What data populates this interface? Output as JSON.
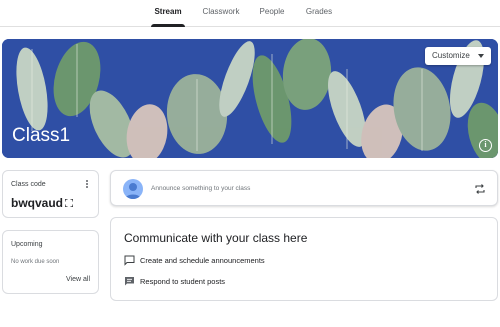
{
  "tabs": [
    {
      "label": "Stream",
      "active": true
    },
    {
      "label": "Classwork",
      "active": false
    },
    {
      "label": "People",
      "active": false
    },
    {
      "label": "Grades",
      "active": false
    }
  ],
  "banner": {
    "class_name": "Class1",
    "customize_label": "Customize",
    "info_glyph": "i",
    "background_color": "#2f4fa5"
  },
  "class_code": {
    "label": "Class code",
    "value": "bwqvaud"
  },
  "upcoming": {
    "title": "Upcoming",
    "empty_text": "No work due soon",
    "view_all_label": "View all"
  },
  "announce": {
    "placeholder": "Announce something to your class"
  },
  "communicate": {
    "title": "Communicate with your class here",
    "items": [
      {
        "icon": "announcement-icon",
        "label": "Create and schedule announcements"
      },
      {
        "icon": "comment-icon",
        "label": "Respond to student posts"
      }
    ]
  },
  "colors": {
    "accent": "#202124",
    "banner_blue": "#2f4fa5",
    "leaf_green": "#6f9a6b",
    "leaf_light": "#c9d6c4"
  }
}
